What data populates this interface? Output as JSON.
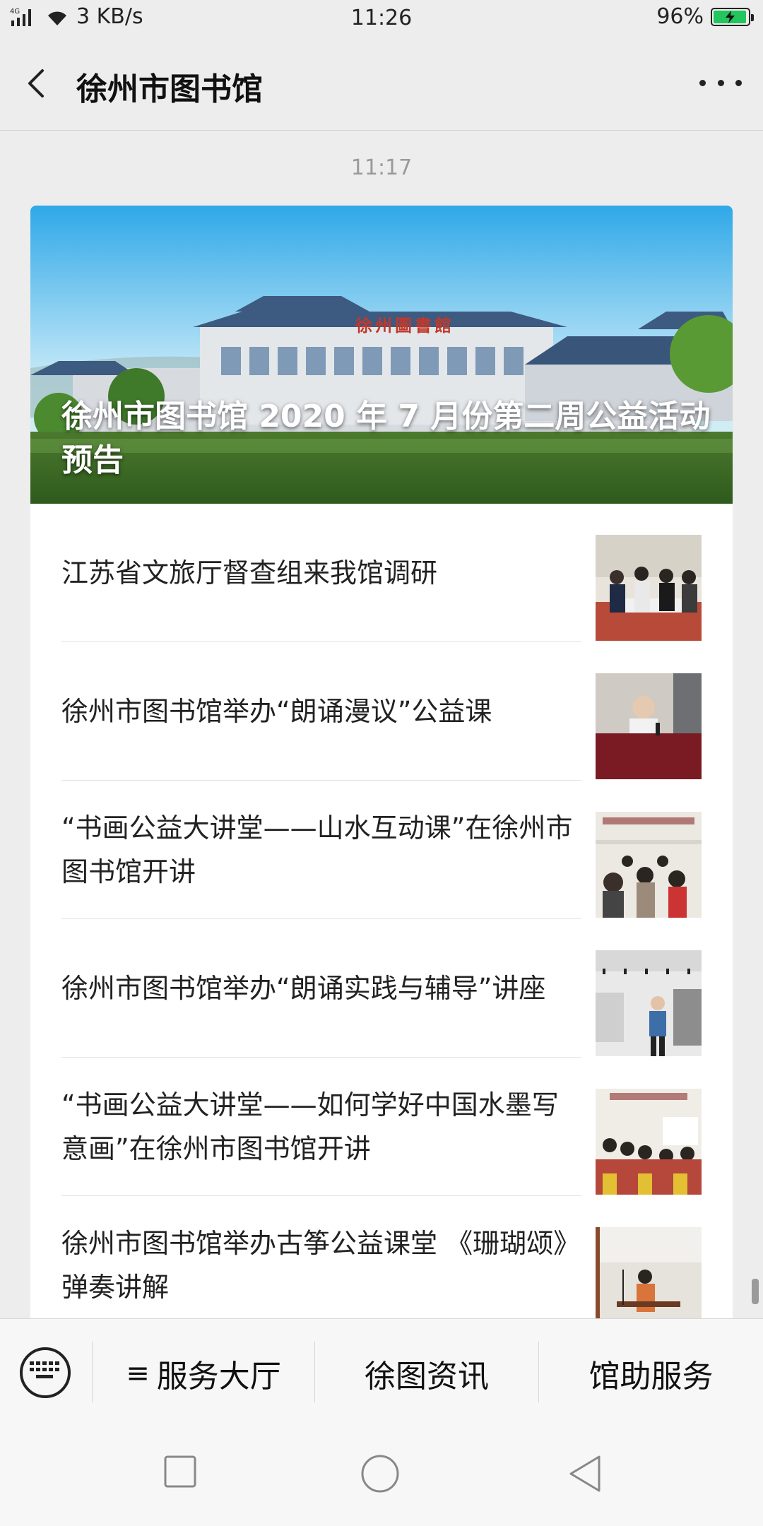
{
  "status_bar": {
    "network": "4G",
    "speed": "3 KB/s",
    "time": "11:26",
    "battery": "96%",
    "battery_level": 0.96
  },
  "nav": {
    "title": "徐州市图书馆"
  },
  "message_time": "11:17",
  "hero": {
    "title": "徐州市图书馆 2020 年 7 月份第二周公益活动预告",
    "sign_text": "徐州圖書館"
  },
  "articles": [
    {
      "title": "江苏省文旅厅督查组来我馆调研"
    },
    {
      "title": "徐州市图书馆举办“朗诵漫议”公益课"
    },
    {
      "title": "“书画公益大讲堂——山水互动课”在徐州市图书馆开讲"
    },
    {
      "title": "徐州市图书馆举办“朗诵实践与辅导”讲座"
    },
    {
      "title": "“书画公益大讲堂——如何学好中国水墨写意画”在徐州市图书馆开讲"
    },
    {
      "title": "徐州市图书馆举办古筝公益课堂 《珊瑚颂》弹奏讲解"
    }
  ],
  "menu": {
    "items": [
      {
        "label": "服务大厅",
        "prefix": "≡"
      },
      {
        "label": "徐图资讯"
      },
      {
        "label": "馆助服务"
      }
    ]
  },
  "colors": {
    "background": "#ededed",
    "battery": "#22c55e",
    "hero_sign": "#c0392b"
  }
}
